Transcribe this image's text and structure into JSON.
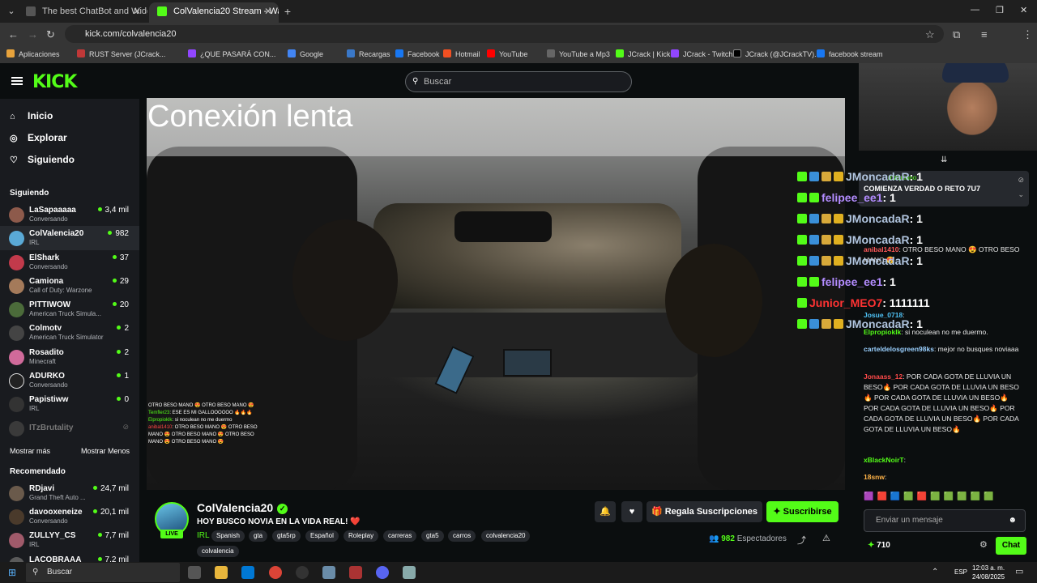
{
  "browser": {
    "tabs": [
      {
        "title": "The best ChatBot and Widgets",
        "active": false
      },
      {
        "title": "ColValencia20 Stream - Wa",
        "active": true
      }
    ],
    "new_tab": "+",
    "url": "kick.com/colvalencia20",
    "bookmarks": [
      "Aplicaciones",
      "RUST Server (JCrack...",
      "¿QUE PASARÁ CON...",
      "Google",
      "Recargas",
      "Facebook",
      "Hotmail",
      "YouTube",
      "YouTube a Mp3",
      "JCrack | Kick",
      "JCrack - Twitch",
      "JCrack (@JCrackTV)...",
      "facebook stream"
    ]
  },
  "site": {
    "logo": "KICK",
    "search_placeholder": "Buscar"
  },
  "sidebar": {
    "nav": [
      {
        "label": "Inicio",
        "icon": "home-icon"
      },
      {
        "label": "Explorar",
        "icon": "compass-icon"
      },
      {
        "label": "Siguiendo",
        "icon": "heart-icon"
      }
    ],
    "following_header": "Siguiendo",
    "following": [
      {
        "name": "LaSapaaaaa",
        "category": "Conversando",
        "viewers": "3,4 mil"
      },
      {
        "name": "ColValencia20",
        "category": "IRL",
        "viewers": "982"
      },
      {
        "name": "ElShark",
        "category": "Conversando",
        "viewers": "37"
      },
      {
        "name": "Camiona",
        "category": "Call of Duty: Warzone",
        "viewers": "29"
      },
      {
        "name": "PITTIWOW",
        "category": "American Truck Simula...",
        "viewers": "20"
      },
      {
        "name": "Colmotv",
        "category": "American Truck Simulator",
        "viewers": "2"
      },
      {
        "name": "Rosadito",
        "category": "Minecraft",
        "viewers": "2"
      },
      {
        "name": "ADURKO",
        "category": "Conversando",
        "viewers": "1"
      },
      {
        "name": "Papistiww",
        "category": "IRL",
        "viewers": "0"
      },
      {
        "name": "ITzBrutality",
        "category": "",
        "viewers": ""
      }
    ],
    "show_more": "Mostrar más",
    "show_less": "Mostrar Menos",
    "recommended_header": "Recomendado",
    "recommended": [
      {
        "name": "RDjavi",
        "category": "Grand Theft Auto ...",
        "viewers": "24,7 mil"
      },
      {
        "name": "davooxeneize",
        "category": "Conversando",
        "viewers": "20,1 mil"
      },
      {
        "name": "ZULLYY_CS",
        "category": "IRL",
        "viewers": "7,7 mil"
      },
      {
        "name": "LACOBRAAA",
        "category": "",
        "viewers": "7,2 mil"
      }
    ]
  },
  "video": {
    "lag_text": "Conexión lenta",
    "overlay_chat": [
      {
        "user": "",
        "text": "OTRO BESO MANO 😍 OTRO BESO MANO 😍"
      },
      {
        "user": "Temfler23",
        "text": ": ESE ES MI GALLOOOOOO 🔥🔥🔥"
      },
      {
        "user": "Elpropioklk",
        "text": ": si noculean no me duermo"
      },
      {
        "user": "anibal1410",
        "text": ": OTRO BESO MANO 😍 OTRO BESO MANO 😍 OTRO BESO MANO 😍 OTRO BESO MANO 😍 OTRO BESO MANO 😍"
      }
    ],
    "alerts": [
      {
        "user": "JMoncadaR",
        "value": ": 1",
        "color": "#b0c4de"
      },
      {
        "user": "felipee_ee1",
        "value": ": 1",
        "color": "#b38cff"
      },
      {
        "user": "JMoncadaR",
        "value": ": 1",
        "color": "#b0c4de"
      },
      {
        "user": "JMoncadaR",
        "value": ": 1",
        "color": "#b0c4de"
      },
      {
        "user": "JMoncadaR",
        "value": ": 1",
        "color": "#b0c4de"
      },
      {
        "user": "felipee_ee1",
        "value": ": 1",
        "color": "#b38cff"
      },
      {
        "user": "Junior_MEO7",
        "value": ": 1111111",
        "color": "#ff3333"
      },
      {
        "user": "JMoncadaR",
        "value": ": 1",
        "color": "#b0c4de"
      }
    ]
  },
  "chat": {
    "pinned_user": "rozquiano",
    "pinned_text": "COMIENZA VERDAD O RETO 7U7",
    "messages": [
      {
        "user": "anibal1410",
        "color": "#ff5a5a",
        "text": ": OTRO BESO MANO 😍 OTRO BESO MANO 😍"
      },
      {
        "user": "Josue_0718",
        "color": "#4fc3f7",
        "text": ":"
      },
      {
        "user": "Elpropioklk",
        "color": "#53fc18",
        "text": ": si noculean no me duermo."
      },
      {
        "user": "carteldelosgreen98ks",
        "color": "#9ad0ff",
        "text": ": mejor no busques noviaaa"
      },
      {
        "user": "Jonaass_12",
        "color": "#ff4a4a",
        "text": ": POR CADA GOTA DE LLUVIA UN BESO🔥 POR CADA GOTA DE LLUVIA UN BESO🔥 POR CADA GOTA DE LLUVIA UN BESO🔥 POR CADA GOTA DE LLUVIA UN BESO🔥 POR CADA GOTA DE LLUVIA UN BESO🔥 POR CADA GOTA DE LLUVIA UN BESO🔥"
      },
      {
        "user": "xBlackNoirT",
        "color": "#53fc18",
        "text": ":"
      },
      {
        "user": "18snw",
        "color": "#ffb347",
        "text": ":"
      }
    ],
    "input_placeholder": "Enviar un mensaje",
    "points": "710",
    "chat_button": "Chat"
  },
  "channel": {
    "name": "ColValencia20",
    "live_badge": "LIVE",
    "title": "HOY BUSCO NOVIA EN LA VIDA REAL! ❤️",
    "category": "IRL",
    "tags": [
      "Spanish",
      "gta",
      "gta5rp",
      "Español",
      "Roleplay",
      "carreras",
      "gta5",
      "carros",
      "colvalencia20",
      "colvalencia"
    ],
    "gift_label": "Regala Suscripciones",
    "subscribe_label": "Suscribirse",
    "viewers": "982",
    "viewers_label": "Espectadores"
  },
  "taskbar": {
    "search_placeholder": "Buscar",
    "lang": "ESP",
    "time": "12:03 a. m.",
    "date": "24/08/2025"
  },
  "colors": {
    "accent": "#53fc18",
    "bg": "#0b0e0f",
    "panel": "#191b1f"
  }
}
